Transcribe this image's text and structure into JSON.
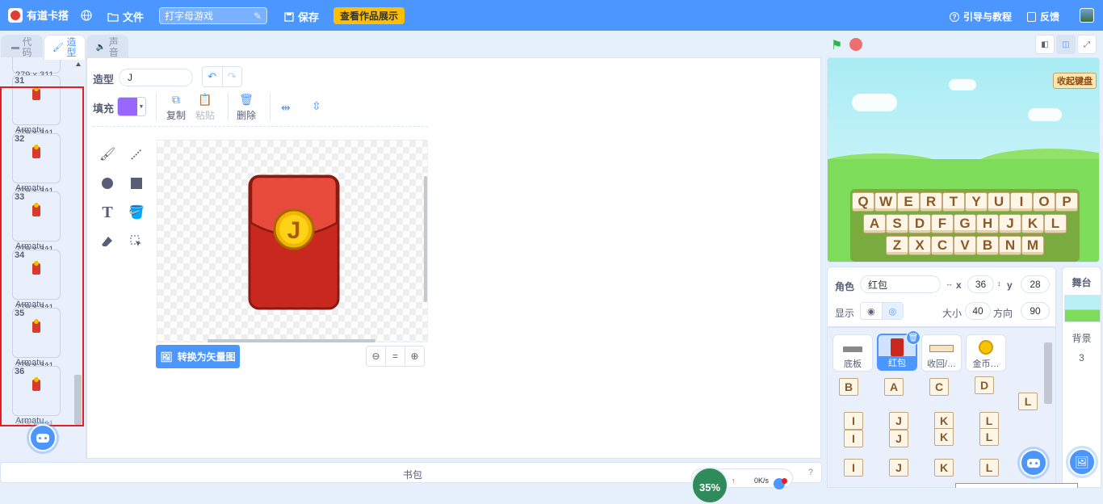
{
  "topbar": {
    "logo_text": "有道卡搭",
    "file_label": "文件",
    "project_name": "打字母游戏",
    "save_label": "保存",
    "showcase_label": "查看作品展示",
    "guide_label": "引导与教程",
    "feedback_label": "反馈"
  },
  "tabs": {
    "code": "代码",
    "costume": "造型",
    "sound": "声音"
  },
  "costumes": {
    "top_partial_name": "Armatu…",
    "items": [
      {
        "num": "31",
        "dim": "279 x 311",
        "name": "Armatu…"
      },
      {
        "num": "32",
        "dim": "279 x 311",
        "name": "Armatu…"
      },
      {
        "num": "33",
        "dim": "279 x 311",
        "name": "Armatu…"
      },
      {
        "num": "34",
        "dim": "279 x 311",
        "name": "Armatu…"
      },
      {
        "num": "35",
        "dim": "279 x 311",
        "name": "Armatu…"
      },
      {
        "num": "36",
        "dim": "279 x 311",
        "name": "Armatu…"
      }
    ],
    "first_dim": "279 x 311",
    "bottom_partial_dim": "279 x 311"
  },
  "paint": {
    "costume_label": "造型",
    "costume_name": "J",
    "fill_label": "填充",
    "fill_color": "#9966ff",
    "copy_label": "复制",
    "paste_label": "粘贴",
    "delete_label": "删除",
    "convert_label": "转换为矢量图",
    "zoom_out": "−",
    "zoom_reset": "=",
    "zoom_in": "+",
    "envelope_letter": "J"
  },
  "backpack": {
    "label": "书包",
    "help": "?"
  },
  "stage": {
    "keyboard_button": "收起键盘",
    "keyboard_rows": [
      [
        "Q",
        "W",
        "E",
        "R",
        "T",
        "Y",
        "U",
        "I",
        "O",
        "P"
      ],
      [
        "A",
        "S",
        "D",
        "F",
        "G",
        "H",
        "J",
        "K",
        "L"
      ],
      [
        "Z",
        "X",
        "C",
        "V",
        "B",
        "N",
        "M"
      ]
    ]
  },
  "sprite_info": {
    "sprite_label": "角色",
    "sprite_name": "红包",
    "x_label": "x",
    "x_value": "36",
    "y_label": "y",
    "y_value": "28",
    "show_label": "显示",
    "size_label": "大小",
    "size_value": "40",
    "direction_label": "方向",
    "direction_value": "90"
  },
  "sprites": {
    "items": [
      {
        "name": "底板"
      },
      {
        "name": "红包"
      },
      {
        "name": "收回/…"
      },
      {
        "name": "金币…"
      }
    ],
    "mini_keys": [
      "B",
      "A",
      "C",
      "D",
      "L",
      "I",
      "J",
      "K",
      "L",
      "I",
      "J",
      "K",
      "L",
      "I",
      "J",
      "K",
      "L"
    ]
  },
  "stage_panel": {
    "title": "舞台",
    "backdrop_label": "背景",
    "backdrop_count": "3"
  },
  "net": {
    "percent": "35%",
    "speed": "0K/s",
    "up_arrow": "↑"
  },
  "colors": {
    "brand": "#4c97ff",
    "highlight": "#e02020",
    "showcase": "#ffbf00"
  }
}
